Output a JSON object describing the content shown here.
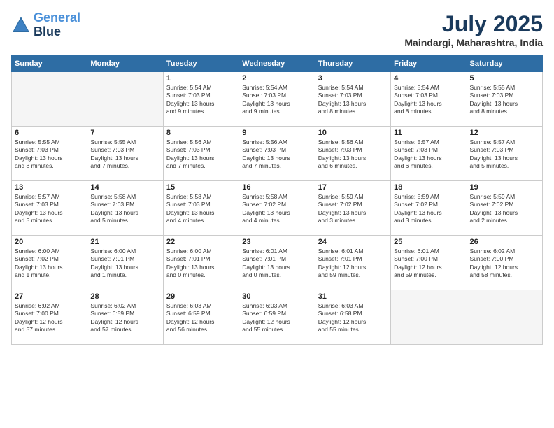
{
  "header": {
    "logo": {
      "line1": "General",
      "line2": "Blue"
    },
    "title": "July 2025",
    "location": "Maindargi, Maharashtra, India"
  },
  "weekdays": [
    "Sunday",
    "Monday",
    "Tuesday",
    "Wednesday",
    "Thursday",
    "Friday",
    "Saturday"
  ],
  "weeks": [
    [
      {
        "day": "",
        "info": ""
      },
      {
        "day": "",
        "info": ""
      },
      {
        "day": "1",
        "info": "Sunrise: 5:54 AM\nSunset: 7:03 PM\nDaylight: 13 hours\nand 9 minutes."
      },
      {
        "day": "2",
        "info": "Sunrise: 5:54 AM\nSunset: 7:03 PM\nDaylight: 13 hours\nand 9 minutes."
      },
      {
        "day": "3",
        "info": "Sunrise: 5:54 AM\nSunset: 7:03 PM\nDaylight: 13 hours\nand 8 minutes."
      },
      {
        "day": "4",
        "info": "Sunrise: 5:54 AM\nSunset: 7:03 PM\nDaylight: 13 hours\nand 8 minutes."
      },
      {
        "day": "5",
        "info": "Sunrise: 5:55 AM\nSunset: 7:03 PM\nDaylight: 13 hours\nand 8 minutes."
      }
    ],
    [
      {
        "day": "6",
        "info": "Sunrise: 5:55 AM\nSunset: 7:03 PM\nDaylight: 13 hours\nand 8 minutes."
      },
      {
        "day": "7",
        "info": "Sunrise: 5:55 AM\nSunset: 7:03 PM\nDaylight: 13 hours\nand 7 minutes."
      },
      {
        "day": "8",
        "info": "Sunrise: 5:56 AM\nSunset: 7:03 PM\nDaylight: 13 hours\nand 7 minutes."
      },
      {
        "day": "9",
        "info": "Sunrise: 5:56 AM\nSunset: 7:03 PM\nDaylight: 13 hours\nand 7 minutes."
      },
      {
        "day": "10",
        "info": "Sunrise: 5:56 AM\nSunset: 7:03 PM\nDaylight: 13 hours\nand 6 minutes."
      },
      {
        "day": "11",
        "info": "Sunrise: 5:57 AM\nSunset: 7:03 PM\nDaylight: 13 hours\nand 6 minutes."
      },
      {
        "day": "12",
        "info": "Sunrise: 5:57 AM\nSunset: 7:03 PM\nDaylight: 13 hours\nand 5 minutes."
      }
    ],
    [
      {
        "day": "13",
        "info": "Sunrise: 5:57 AM\nSunset: 7:03 PM\nDaylight: 13 hours\nand 5 minutes."
      },
      {
        "day": "14",
        "info": "Sunrise: 5:58 AM\nSunset: 7:03 PM\nDaylight: 13 hours\nand 5 minutes."
      },
      {
        "day": "15",
        "info": "Sunrise: 5:58 AM\nSunset: 7:03 PM\nDaylight: 13 hours\nand 4 minutes."
      },
      {
        "day": "16",
        "info": "Sunrise: 5:58 AM\nSunset: 7:02 PM\nDaylight: 13 hours\nand 4 minutes."
      },
      {
        "day": "17",
        "info": "Sunrise: 5:59 AM\nSunset: 7:02 PM\nDaylight: 13 hours\nand 3 minutes."
      },
      {
        "day": "18",
        "info": "Sunrise: 5:59 AM\nSunset: 7:02 PM\nDaylight: 13 hours\nand 3 minutes."
      },
      {
        "day": "19",
        "info": "Sunrise: 5:59 AM\nSunset: 7:02 PM\nDaylight: 13 hours\nand 2 minutes."
      }
    ],
    [
      {
        "day": "20",
        "info": "Sunrise: 6:00 AM\nSunset: 7:02 PM\nDaylight: 13 hours\nand 1 minute."
      },
      {
        "day": "21",
        "info": "Sunrise: 6:00 AM\nSunset: 7:01 PM\nDaylight: 13 hours\nand 1 minute."
      },
      {
        "day": "22",
        "info": "Sunrise: 6:00 AM\nSunset: 7:01 PM\nDaylight: 13 hours\nand 0 minutes."
      },
      {
        "day": "23",
        "info": "Sunrise: 6:01 AM\nSunset: 7:01 PM\nDaylight: 13 hours\nand 0 minutes."
      },
      {
        "day": "24",
        "info": "Sunrise: 6:01 AM\nSunset: 7:01 PM\nDaylight: 12 hours\nand 59 minutes."
      },
      {
        "day": "25",
        "info": "Sunrise: 6:01 AM\nSunset: 7:00 PM\nDaylight: 12 hours\nand 59 minutes."
      },
      {
        "day": "26",
        "info": "Sunrise: 6:02 AM\nSunset: 7:00 PM\nDaylight: 12 hours\nand 58 minutes."
      }
    ],
    [
      {
        "day": "27",
        "info": "Sunrise: 6:02 AM\nSunset: 7:00 PM\nDaylight: 12 hours\nand 57 minutes."
      },
      {
        "day": "28",
        "info": "Sunrise: 6:02 AM\nSunset: 6:59 PM\nDaylight: 12 hours\nand 57 minutes."
      },
      {
        "day": "29",
        "info": "Sunrise: 6:03 AM\nSunset: 6:59 PM\nDaylight: 12 hours\nand 56 minutes."
      },
      {
        "day": "30",
        "info": "Sunrise: 6:03 AM\nSunset: 6:59 PM\nDaylight: 12 hours\nand 55 minutes."
      },
      {
        "day": "31",
        "info": "Sunrise: 6:03 AM\nSunset: 6:58 PM\nDaylight: 12 hours\nand 55 minutes."
      },
      {
        "day": "",
        "info": ""
      },
      {
        "day": "",
        "info": ""
      }
    ]
  ]
}
